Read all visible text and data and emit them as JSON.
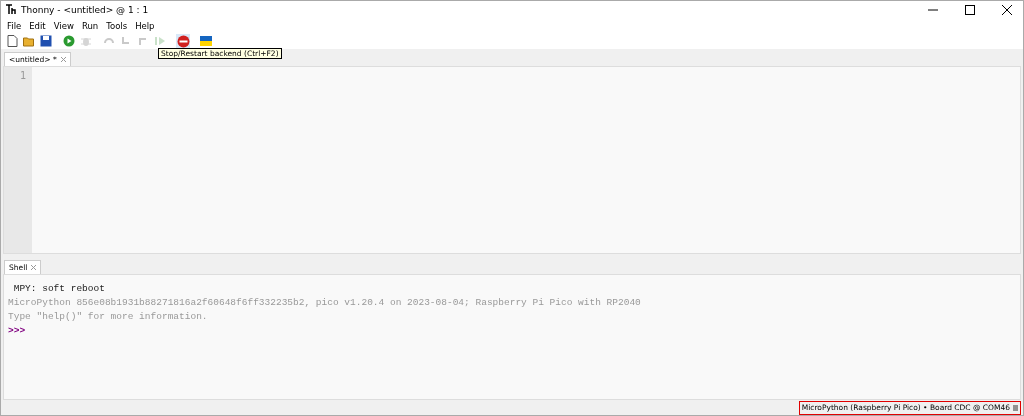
{
  "window": {
    "title": "Thonny  -  <untitled>  @  1 : 1"
  },
  "menu": [
    "File",
    "Edit",
    "View",
    "Run",
    "Tools",
    "Help"
  ],
  "toolbar": [
    {
      "kind": "new",
      "disabled": false
    },
    {
      "kind": "open",
      "disabled": false
    },
    {
      "kind": "save",
      "disabled": false
    },
    {
      "kind": "run",
      "disabled": false
    },
    {
      "kind": "debug",
      "disabled": true
    },
    {
      "kind": "step_over",
      "disabled": true
    },
    {
      "kind": "step_into",
      "disabled": true
    },
    {
      "kind": "step_out",
      "disabled": true
    },
    {
      "kind": "resume",
      "disabled": true
    },
    {
      "kind": "stop",
      "disabled": false
    },
    {
      "kind": "flag",
      "disabled": false
    }
  ],
  "tooltip": "Stop/Restart backend (Ctrl+F2)",
  "editor": {
    "tabs": [
      {
        "label": "<untitled> *",
        "selected": true
      }
    ],
    "line_numbers": [
      "1"
    ]
  },
  "shell": {
    "tab": {
      "label": "Shell",
      "selected": true
    },
    "lines": [
      {
        "kind": "output",
        "text": " MPY: soft reboot"
      },
      {
        "kind": "info",
        "text": "MicroPython 856e08b1931b88271816a2f60648f6ff332235b2, pico v1.20.4 on 2023-08-04; Raspberry Pi Pico with RP2040"
      },
      {
        "kind": "info",
        "text": "Type \"help()\" for more information."
      },
      {
        "kind": "prompt",
        "text": ">>>"
      }
    ]
  },
  "status_bar": {
    "interpreter": "MicroPython (Raspberry Pi Pico)  •  Board CDC @ COM46"
  }
}
